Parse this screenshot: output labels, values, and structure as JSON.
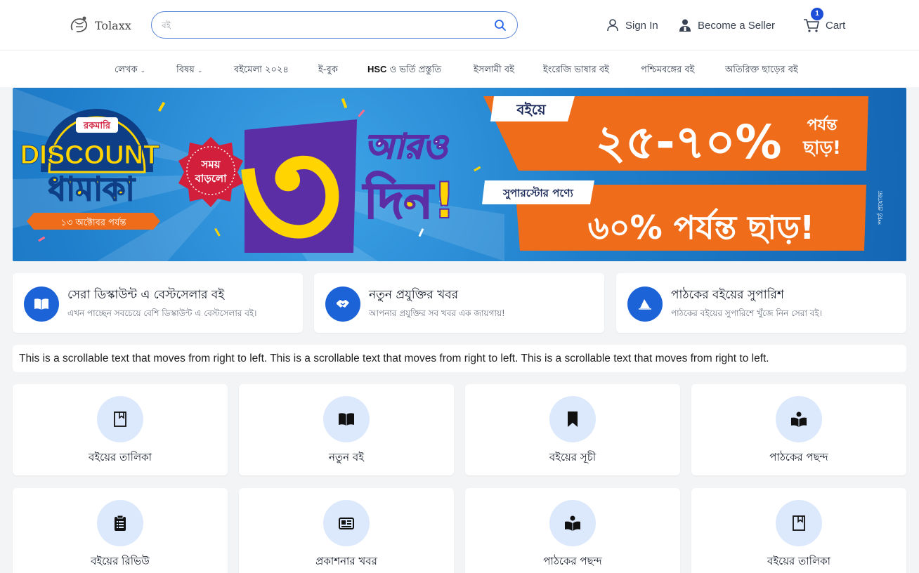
{
  "header": {
    "logo_text": "Tolaxx",
    "search": {
      "value": "",
      "placeholder": "বই"
    },
    "signin_label": "Sign In",
    "seller_label": "Become a Seller",
    "cart_label": "Cart",
    "cart_count": "1"
  },
  "nav": {
    "items": [
      {
        "label": "লেখক",
        "has_dropdown": true
      },
      {
        "label": "বিষয়",
        "has_dropdown": true
      },
      {
        "label": "বইমেলা ২০২৪",
        "has_dropdown": false
      },
      {
        "label": "ই-বুক",
        "has_dropdown": false
      },
      {
        "label_bold": "HSC",
        "label": " ও ভর্তি প্রস্তুতি",
        "has_dropdown": false
      },
      {
        "label": "ইসলামী বই",
        "has_dropdown": false
      },
      {
        "label": "ইংরেজি ভাষার বই",
        "has_dropdown": false
      },
      {
        "label": "পশ্চিমবঙ্গের বই",
        "has_dropdown": false
      },
      {
        "label": "অতিরিক্ত ছাড়ের বই",
        "has_dropdown": false
      }
    ],
    "chevron": "⌄"
  },
  "banner": {
    "brand_badge": "রকমারি",
    "discount_word": "DISCOUNT",
    "dhamaka": "ধামাকা",
    "date_ribbon": "১৩ অক্টোবর পর্যন্ত",
    "time_extended": "সময় বাড়লো",
    "big_number": "৩",
    "more": "আরও",
    "days": "দিন!",
    "book_tag": "বইয়ে",
    "book_discount": "২৫-৭০%",
    "book_discount_suffix_1": "পর্যন্ত",
    "book_discount_suffix_2": "ছাড়!",
    "superstore_tag": "সুপারস্টোর পণ্যে",
    "superstore_discount": "৬০% পর্যন্ত ছাড়!",
    "side_note": "*শর্ত প্রযোজ্য",
    "colors": {
      "orange": "#ef6c1a",
      "yellow": "#ffd400",
      "purple": "#5b2ea6",
      "blue": "#1f7fcc"
    }
  },
  "features": [
    {
      "icon": "open-book-icon",
      "title": "সেরা ডিস্কাউন্ট এ বেস্টসেলার বই",
      "subtitle": "এখন পাচ্ছেন সবচেয়ে বেশি ডিস্কাউন্ট এ বেস্টসেলার বই।"
    },
    {
      "icon": "handshake-icon",
      "title": "নতুন প্রযুক্তির খবর",
      "subtitle": "আপনার প্রযুক্তির সব খবর এক জায়গায়!"
    },
    {
      "icon": "sailboat-icon",
      "title": "পাঠকের বইয়ের সুপারিশ",
      "subtitle": "পাঠকের বইয়ের সুপারিশে খুঁজে নিন সেরা বই।"
    }
  ],
  "marquee_text": "This is a scrollable text that moves from right to left. This is a scrollable text that moves from right to left. This is a scrollable text that moves from right to left.",
  "categories": [
    {
      "icon": "bookmark-outline-icon",
      "label": "বইয়ের তালিকা"
    },
    {
      "icon": "open-book-icon",
      "label": "নতুন বই"
    },
    {
      "icon": "bookmark-icon",
      "label": "বইয়ের সূচী"
    },
    {
      "icon": "reader-icon",
      "label": "পাঠকের পছন্দ"
    },
    {
      "icon": "clipboard-icon",
      "label": "বইয়ের রিভিউ"
    },
    {
      "icon": "newspaper-icon",
      "label": "প্রকাশনার খবর"
    },
    {
      "icon": "reader-icon",
      "label": "পাঠকের পছন্দ"
    },
    {
      "icon": "bookmark-outline-icon",
      "label": "বইয়ের তালিকা"
    }
  ]
}
